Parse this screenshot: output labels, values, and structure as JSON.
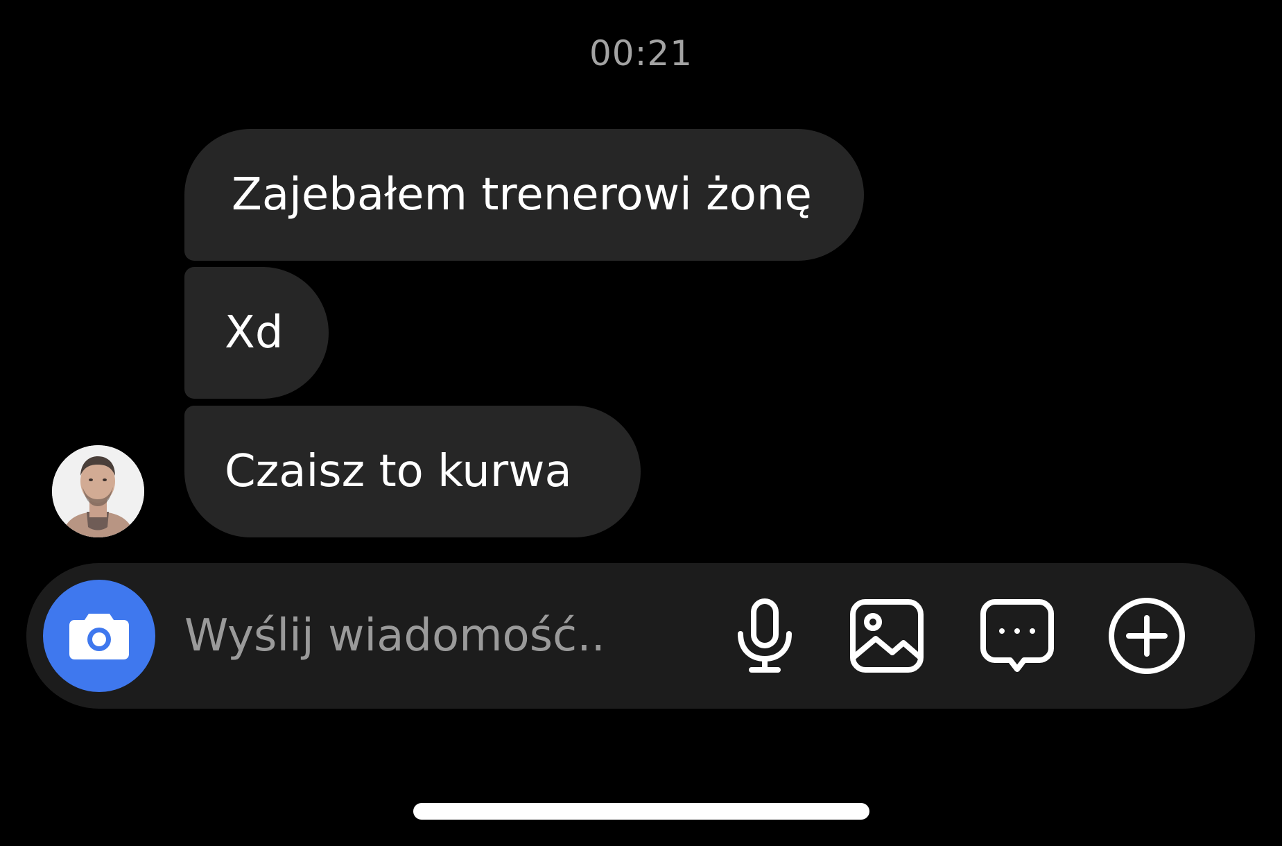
{
  "timestamp": "00:21",
  "messages": [
    {
      "text": "Zajebałem trenerowi żonę"
    },
    {
      "text": "Xd"
    },
    {
      "text": "Czaisz to kurwa"
    }
  ],
  "composer": {
    "placeholder": "Wyślij wiadomość...",
    "value": ""
  },
  "icons": {
    "camera": "camera-icon",
    "microphone": "microphone-icon",
    "gallery": "gallery-icon",
    "sticker": "sticker-icon",
    "add": "plus-circle-icon"
  },
  "colors": {
    "background": "#000000",
    "bubble": "#262626",
    "composer": "#1c1c1c",
    "camera_button": "#3f78ee",
    "timestamp": "#a3a3a3",
    "placeholder": "#9a9a9a"
  }
}
